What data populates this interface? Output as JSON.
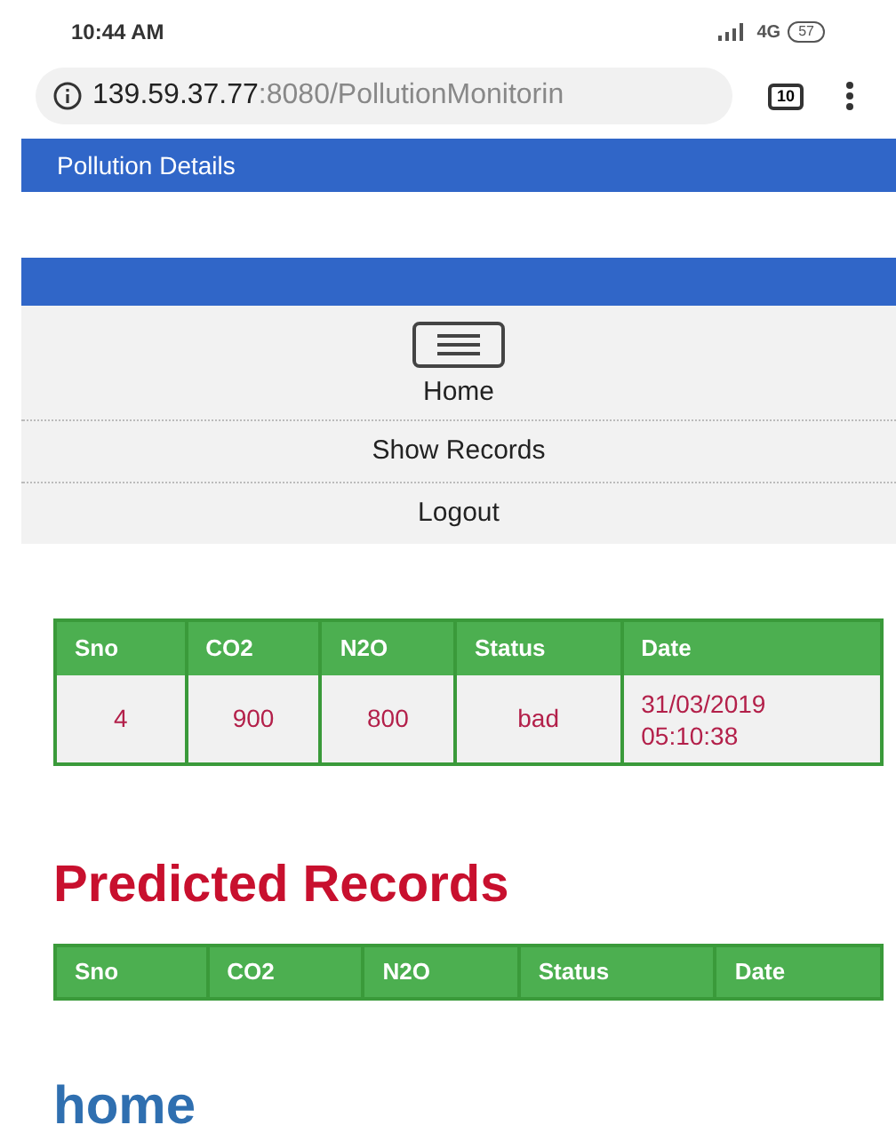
{
  "status_bar": {
    "time": "10:44 AM",
    "network": "4G",
    "battery": "57"
  },
  "browser": {
    "url_host": "139.59.37.77",
    "url_path": ":8080/PollutionMonitorin",
    "tab_count": "10"
  },
  "header": {
    "title": "Pollution Details"
  },
  "nav": {
    "items": [
      "Home",
      "Show Records",
      "Logout"
    ]
  },
  "records_table": {
    "columns": [
      "Sno",
      "CO2",
      "N2O",
      "Status",
      "Date"
    ],
    "rows": [
      [
        "4",
        "900",
        "800",
        "bad",
        "31/03/2019 05:10:38"
      ]
    ]
  },
  "predicted": {
    "title": "Predicted Records",
    "columns": [
      "Sno",
      "CO2",
      "N2O",
      "Status",
      "Date"
    ]
  },
  "footer_heading": "home"
}
